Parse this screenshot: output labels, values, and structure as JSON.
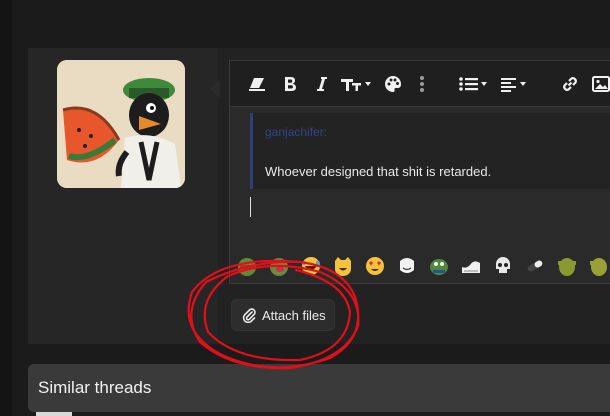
{
  "toolbar": {
    "items": [
      {
        "icon": "eraser-icon"
      },
      {
        "icon": "bold-icon"
      },
      {
        "icon": "italic-icon"
      },
      {
        "icon": "text-size-icon"
      },
      {
        "icon": "palette-icon"
      },
      {
        "icon": "more-vertical-icon"
      },
      {
        "icon": "list-icon"
      },
      {
        "icon": "align-left-icon"
      },
      {
        "icon": "link-icon"
      },
      {
        "icon": "image-icon"
      }
    ]
  },
  "quote": {
    "author": "ganjachifer:",
    "text": "Whoever designed that shit is retarded."
  },
  "emojis": [
    "pepe-emoji-icon",
    "kiss-emoji-icon",
    "laugh-emoji-icon",
    "cat-joy-emoji-icon",
    "heart-eyes-emoji-icon",
    "trollface-emoji-icon",
    "pepe-frog-emoji-icon",
    "wave-emoji-icon",
    "skull-emoji-icon",
    "pill-emoji-icon",
    "shrek-emoji-icon",
    "shrek-2-emoji-icon"
  ],
  "attach": {
    "label": "Attach files",
    "icon": "paperclip-icon"
  },
  "similar": {
    "title": "Similar threads"
  },
  "colors": {
    "accent_quote": "#2f3f78",
    "annotation_circle": "#e0101a"
  }
}
